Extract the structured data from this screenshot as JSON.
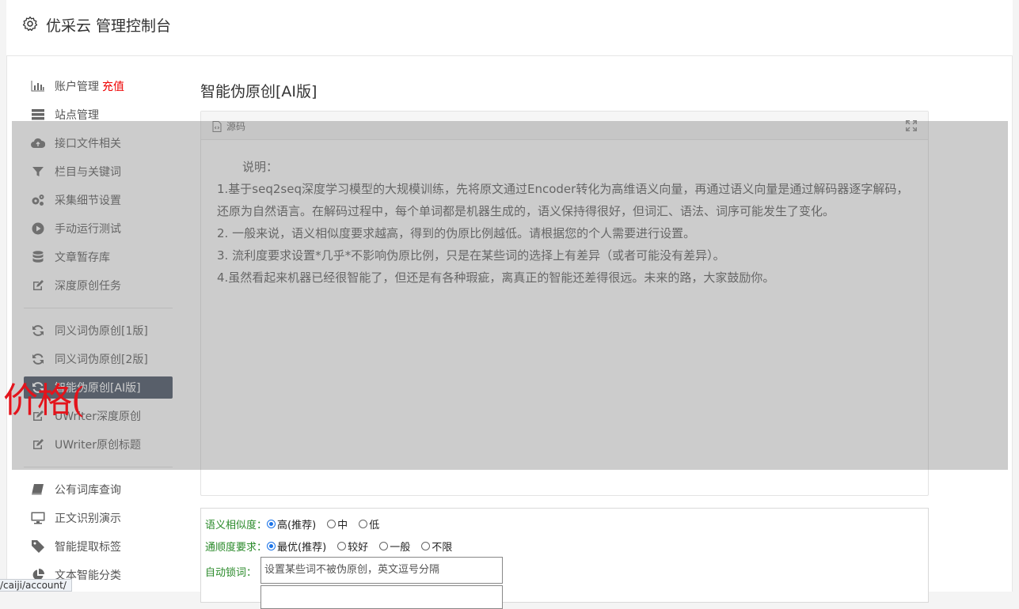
{
  "header": {
    "title": "优采云 管理控制台",
    "icon": "gear-icon"
  },
  "sidebar": {
    "items": [
      {
        "label": "账户管理",
        "badge": "充值",
        "icon": "bar-chart-icon"
      },
      {
        "label": "站点管理",
        "icon": "server-icon"
      },
      {
        "label": "接口文件相关",
        "icon": "cloud-upload-icon"
      },
      {
        "label": "栏目与关键词",
        "icon": "filter-icon"
      },
      {
        "label": "采集细节设置",
        "icon": "gears-icon"
      },
      {
        "label": "手动运行测试",
        "icon": "play-circle-icon"
      },
      {
        "label": "文章暂存库",
        "icon": "database-icon"
      },
      {
        "label": "深度原创任务",
        "icon": "edit-icon"
      },
      {
        "label": "同义词伪原创[1版]",
        "icon": "refresh-icon"
      },
      {
        "label": "同义词伪原创[2版]",
        "icon": "refresh-icon"
      },
      {
        "label": "智能伪原创[AI版]",
        "icon": "refresh-icon",
        "active": true
      },
      {
        "label": "UWriter深度原创",
        "icon": "edit-icon"
      },
      {
        "label": "UWriter原创标题",
        "icon": "edit-icon"
      },
      {
        "label": "公有词库查询",
        "icon": "book-icon"
      },
      {
        "label": "正文识别演示",
        "icon": "monitor-icon"
      },
      {
        "label": "智能提取标签",
        "icon": "tag-icon"
      },
      {
        "label": "文本智能分类",
        "icon": "pie-chart-icon"
      }
    ]
  },
  "main": {
    "title": "智能伪原创[AI版]",
    "editor": {
      "toolbar_label": "源码",
      "lines": [
        "说明：",
        "1.基于seq2seq深度学习模型的大规模训练，先将原文通过Encoder转化为高维语义向量，再通过语义向量是通过解码器逐字解码，还原为自然语言。在解码过程中，每个单词都是机器生成的，语义保持得很好，但词汇、语法、词序可能发生了变化。",
        "2. 一般来说，语义相似度要求越高，得到的伪原比例越低。请根据您的个人需要进行设置。",
        "3. 流利度要求设置*几乎*不影响伪原比例，只是在某些词的选择上有差异（或者可能没有差异）。",
        "4.虽然看起来机器已经很智能了，但还是有各种瑕疵，离真正的智能还差得很远。未来的路，大家鼓励你。"
      ]
    },
    "options": {
      "similarity_label": "语义相似度：",
      "similarity": [
        "高(推荐)",
        "中",
        "低"
      ],
      "fluency_label": "通顺度要求：",
      "fluency": [
        "最优(推荐)",
        "较好",
        "一般",
        "不限"
      ],
      "lock_label": "自动锁词：",
      "lock_placeholder": "设置某些词不被伪原创，英文逗号分隔"
    }
  },
  "overlay_text": "价格(",
  "status_url": "/caiji/account/",
  "colors": {
    "active_nav": "#3e4a5c",
    "badge": "#e00000",
    "option_label": "#2a8a2a",
    "overlay_text": "#e3141c"
  }
}
